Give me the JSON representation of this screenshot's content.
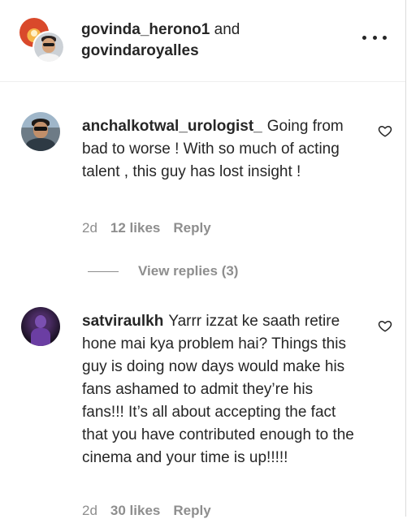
{
  "header": {
    "user1": "govinda_herono1",
    "joiner": "and",
    "user2": "govindaroyalles"
  },
  "comments": [
    {
      "username": "anchalkotwal_urologist_",
      "text": "Going from bad to worse ! With so much of acting talent , this guy has lost insight !",
      "time": "2d",
      "likes": "12 likes",
      "reply": "Reply",
      "view_replies": "View replies (3)"
    },
    {
      "username": "satviraulkh",
      "text": "Yarrr izzat ke saath retire hone mai kya problem hai? Things this guy is doing now days would make his fans ashamed to admit they’re his fans!!! It’s all about accepting the fact that you have contributed enough to the cinema and your time is up!!!!!",
      "time": "2d",
      "likes": "30 likes",
      "reply": "Reply"
    }
  ],
  "colors": {
    "text": "#262626",
    "secondary": "#8e8e8e",
    "divider": "#efefef"
  },
  "icons": [
    "more-options-icon",
    "heart-icon"
  ]
}
